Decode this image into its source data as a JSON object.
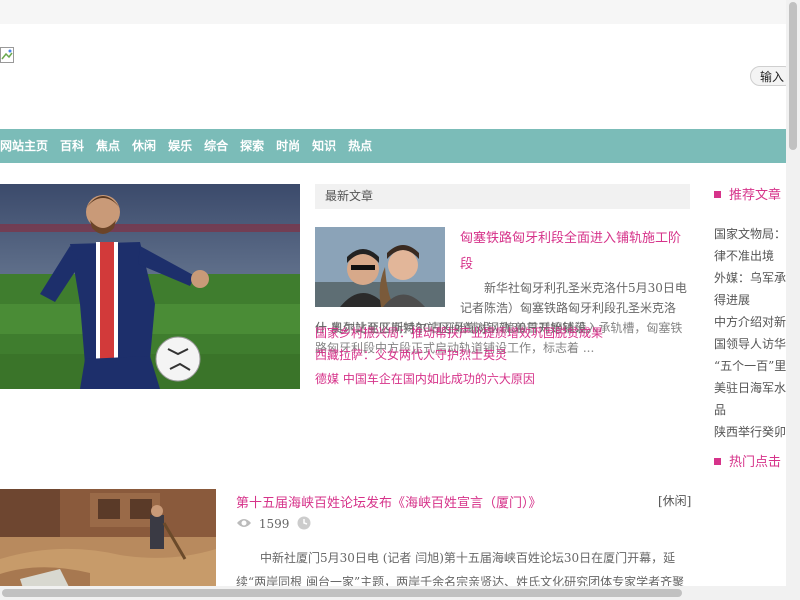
{
  "search": {
    "button_label": "输入"
  },
  "nav": {
    "items": [
      "网站主页",
      "百科",
      "焦点",
      "休闲",
      "娱乐",
      "综合",
      "探索",
      "时尚",
      "知识",
      "热点"
    ]
  },
  "latest": {
    "header": "最新文章",
    "featured": {
      "title": "匈塞铁路匈牙利段全面进入铺轨施工阶段",
      "text": "新华社匈牙利孔圣米克洛什5月30日电 记者陈浩）匈塞铁路匈牙利段孔圣米克洛",
      "text_cont": "什-凯列比亚区间对30日开始铺设，随着首对钢轨落入承轨槽，匈塞铁路匈牙利段中方段正式启动轨道铺设工作，标志着 ...",
      "overlap": "什-奥尔站至匹斯特尔站区间首对钢轨30日开始铺设。"
    },
    "links": [
      "国家乡村振兴局：推动帮扶产业提质增效巩固脱贫成果",
      "西藏拉萨：父女两代人守护烈士英灵",
      "德媒 中国车企在国内如此成功的六大原因"
    ]
  },
  "sidebar": {
    "recommend_header": "推荐文章",
    "recommend": [
      "国家文物局：",
      "律不准出境",
      "外媒：乌军承",
      "得进展",
      "中方介绍对新",
      "国领导人访华",
      "“五个一百”里",
      "美驻日海军水",
      "品",
      "陕西举行癸卯"
    ],
    "hot_header": "热门点击"
  },
  "article2": {
    "title": "第十五届海峡百姓论坛发布《海峡百姓宣言（厦门）》",
    "category": "[休闲]",
    "views": "1599",
    "text": "中新社厦门5月30日电 (记者 闫旭)第十五届海峡百姓论坛30日在厦门开幕，延续“两岸同根 闽台一家”主题，两岸千余名宗亲贤达、姓氏文化研究团体专家学者齐聚"
  },
  "colors": {
    "accent": "#d6338a",
    "nav_bg": "#7bbcb8"
  }
}
